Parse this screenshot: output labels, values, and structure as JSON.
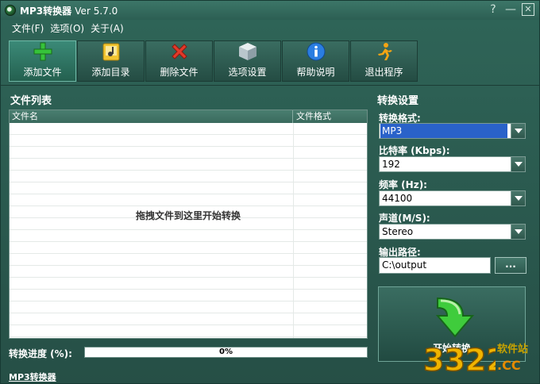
{
  "window": {
    "title": "MP3转换器",
    "version": "Ver 5.7.0",
    "controls": {
      "help": "?",
      "minimize": "—",
      "close": "✕"
    }
  },
  "menu": [
    "文件(F)",
    "选项(O)",
    "关于(A)"
  ],
  "toolbar": [
    {
      "label": "添加文件",
      "icon": "add-file-icon",
      "active": true
    },
    {
      "label": "添加目录",
      "icon": "add-folder-icon"
    },
    {
      "label": "删除文件",
      "icon": "delete-icon"
    },
    {
      "label": "选项设置",
      "icon": "settings-cube-icon"
    },
    {
      "label": "帮助说明",
      "icon": "info-icon"
    },
    {
      "label": "退出程序",
      "icon": "exit-runner-icon"
    }
  ],
  "file_list": {
    "title": "文件列表",
    "columns": [
      "文件名",
      "文件格式"
    ],
    "empty_hint": "拖拽文件到这里开始转换"
  },
  "progress": {
    "label": "转换进度 (%):",
    "value_text": "0%",
    "value": 0
  },
  "footer": {
    "link": "MP3转换器"
  },
  "settings": {
    "title": "转换设置",
    "format": {
      "label": "转换格式:",
      "value": "MP3"
    },
    "bitrate": {
      "label": "比特率 (Kbps):",
      "value": "192"
    },
    "frequency": {
      "label": "频率 (Hz):",
      "value": "44100"
    },
    "channel": {
      "label": "声道(M/S):",
      "value": "Stereo"
    },
    "output": {
      "label": "输出路径:",
      "value": "C:\\output",
      "browse": "..."
    },
    "start_label": "开始转换"
  },
  "watermark": {
    "site": "软件站",
    "domain": ".CC",
    "brand": "3322"
  },
  "colors": {
    "accent": "#2a62c9",
    "background": "#2a5a4f",
    "progress": "#3fa05a"
  }
}
